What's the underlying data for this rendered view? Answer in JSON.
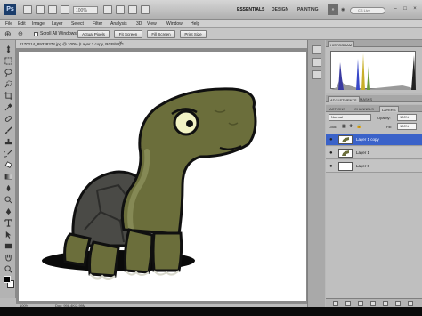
{
  "app": {
    "logo": "Ps",
    "zoom_value": "100%",
    "workspaces": [
      "ESSENTIALS",
      "DESIGN",
      "PAINTING"
    ],
    "more_label": "»",
    "cs_live_label": "CS Live",
    "window_controls": [
      "–",
      "□",
      "×"
    ]
  },
  "menu": [
    "File",
    "Edit",
    "Image",
    "Layer",
    "Select",
    "Filter",
    "Analysis",
    "3D",
    "View",
    "Window",
    "Help"
  ],
  "options_bar": {
    "checkbox_label": "Scroll All Windows",
    "buttons": [
      "Actual Pixels",
      "Fit Screen",
      "Fill Screen",
      "Print Size"
    ]
  },
  "document": {
    "tab_title": "1170214_89338378.jpg @ 100% (Layer 1 copy, RGB/8#) *",
    "close_glyph": "×",
    "status_zoom": "100%",
    "status_doc": "Doc: 998.4K/2.99M"
  },
  "panels": {
    "top_tabs": [
      "HISTOGRAM"
    ],
    "mid_tabs": [
      "ADJUSTMENTS",
      "MASKS"
    ],
    "layer_tabs": [
      "ACTIONS",
      "CHANNELS",
      "LAYERS"
    ],
    "active_layer_tab": "LAYERS",
    "blend_mode": "Normal",
    "opacity_label": "Opacity:",
    "opacity_value": "100%",
    "lock_label": "Lock:",
    "fill_label": "Fill:",
    "fill_value": "100%",
    "layers": [
      {
        "name": "Layer 1 copy",
        "selected": true
      },
      {
        "name": "Layer 1",
        "selected": false
      },
      {
        "name": "Layer 0",
        "selected": false
      }
    ]
  },
  "colors": {
    "selection": "#3a62c9",
    "turtle_skin": "#6b6e3b",
    "turtle_shell": "#4a4a46"
  }
}
